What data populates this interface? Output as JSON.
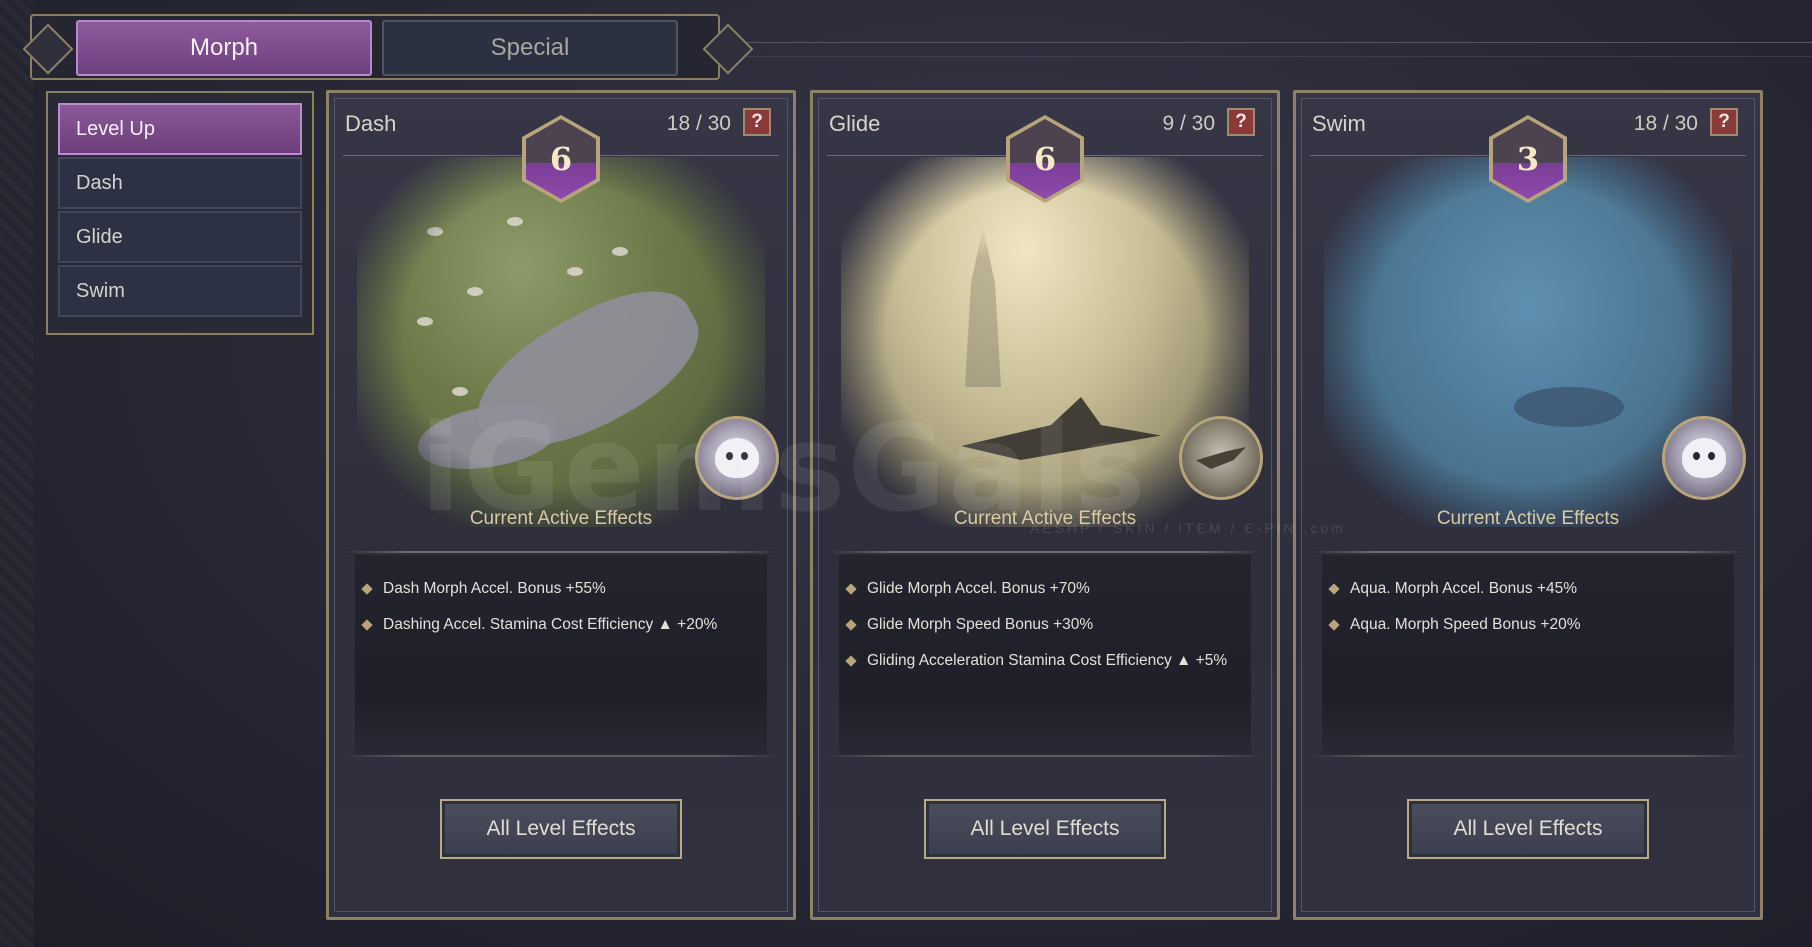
{
  "tabs": [
    {
      "label": "Morph",
      "active": true
    },
    {
      "label": "Special",
      "active": false
    }
  ],
  "menu": [
    {
      "label": "Level Up",
      "active": true
    },
    {
      "label": "Dash",
      "active": false
    },
    {
      "label": "Glide",
      "active": false
    },
    {
      "label": "Swim",
      "active": false
    }
  ],
  "cards": [
    {
      "title": "Dash",
      "progress": "18 / 30",
      "help": "?",
      "level": "6",
      "effects_title": "Current Active Effects",
      "effects": [
        "Dash Morph Accel. Bonus +55%",
        "Dashing Accel. Stamina Cost Efficiency ▲ +20%"
      ],
      "button": "All Level Effects",
      "avatar_icon": "snow-leopard-icon"
    },
    {
      "title": "Glide",
      "progress": "9 / 30",
      "help": "?",
      "level": "6",
      "effects_title": "Current Active Effects",
      "effects": [
        "Glide Morph Accel. Bonus +70%",
        "Glide Morph Speed Bonus  +30%",
        "Gliding Acceleration Stamina Cost Efficiency ▲ +5%"
      ],
      "button": "All Level Effects",
      "avatar_icon": "bird-icon"
    },
    {
      "title": "Swim",
      "progress": "18 / 30",
      "help": "?",
      "level": "3",
      "effects_title": "Current Active Effects",
      "effects": [
        "Aqua. Morph Accel. Bonus +45%",
        "Aqua. Morph Speed Bonus +20%"
      ],
      "button": "All Level Effects",
      "avatar_icon": "seal-pup-icon"
    }
  ],
  "watermark": {
    "main": "iGemsGals",
    "sub": "AESHP / SKIN / ITEM / E-PIN .com"
  },
  "colors": {
    "accent_purple": "#7a4a8c",
    "gold_border": "#8e8266",
    "help_red": "#8a3a3a"
  }
}
